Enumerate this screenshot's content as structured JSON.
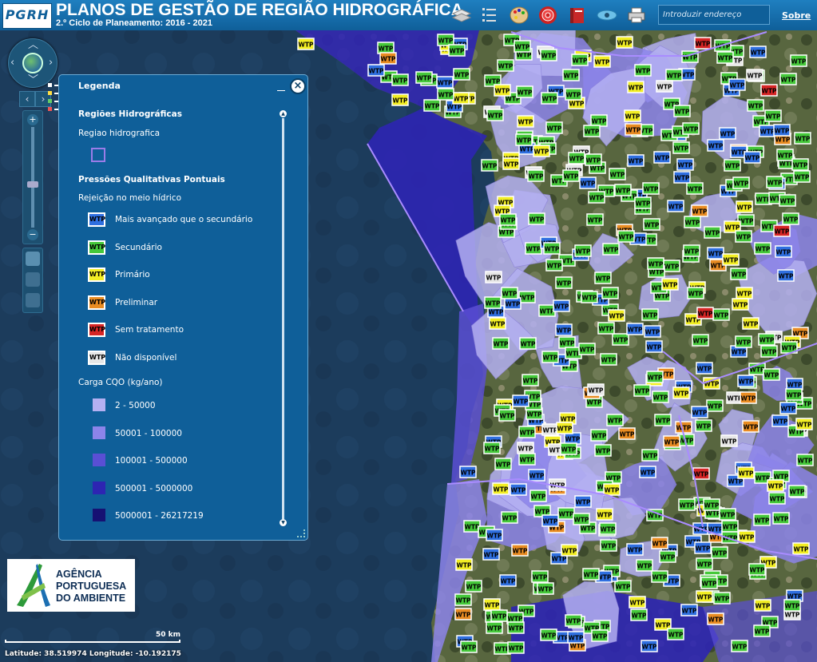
{
  "header": {
    "logo_text": "PGRH",
    "title": "PLANOS DE GESTÃO DE REGIÃO HIDROGRÁFICA",
    "subtitle": "2.º Ciclo de Planeamento: 2016 - 2021",
    "toolbar": [
      {
        "name": "layers-icon"
      },
      {
        "name": "legend-list-icon"
      },
      {
        "name": "palette-icon"
      },
      {
        "name": "target-icon"
      },
      {
        "name": "book-icon"
      },
      {
        "name": "eye-icon"
      },
      {
        "name": "printer-icon"
      }
    ],
    "address_placeholder": "Introduzir endereço",
    "about_label": "Sobre"
  },
  "legend": {
    "title": "Legenda",
    "sections": [
      {
        "heading": "Regiões Hidrográficas",
        "subheading": "Regiao hidrografica"
      },
      {
        "heading": "Pressões Qualitativas Pontuais",
        "subheading": "Rejeição no meio hídrico",
        "icon_text": "WTP",
        "items": [
          {
            "label": "Mais avançado que o secundário",
            "color": "#2f6fe0",
            "text_color": "#000000"
          },
          {
            "label": "Secundário",
            "color": "#45c83a",
            "text_color": "#000000"
          },
          {
            "label": "Primário",
            "color": "#f2ee24",
            "text_color": "#000000"
          },
          {
            "label": "Preliminar",
            "color": "#e98c22",
            "text_color": "#000000"
          },
          {
            "label": "Sem tratamento",
            "color": "#d62525",
            "text_color": "#000000"
          },
          {
            "label": "Não disponível",
            "color": "#e6e6e6",
            "text_color": "#000000"
          }
        ]
      },
      {
        "heading": "Carga CQO (kg/ano)",
        "items": [
          {
            "label": "2 - 50000",
            "color": "#b4b0f2"
          },
          {
            "label": "50001 - 100000",
            "color": "#8c84ea"
          },
          {
            "label": "100001 - 500000",
            "color": "#5a4fd4"
          },
          {
            "label": "500001 - 5000000",
            "color": "#2d25b2"
          },
          {
            "label": "5000001 - 26217219",
            "color": "#161173"
          }
        ]
      }
    ]
  },
  "logo": {
    "lines": [
      "AGÊNCIA",
      "PORTUGUESA",
      "DO AMBIENTE"
    ]
  },
  "scale": {
    "label": "50 km"
  },
  "coordinates": {
    "text": "Latitude: 38.519974   Longitude: -10.192175"
  },
  "map": {
    "marker_text": "WTP",
    "colors": {
      "ocean": "#1c3c5c",
      "land": "#4a5a3c",
      "region_light": "#b4b0f2",
      "region_mid": "#8c84ea",
      "region_dark": "#2d25b2",
      "region_border": "#a98cff"
    }
  }
}
